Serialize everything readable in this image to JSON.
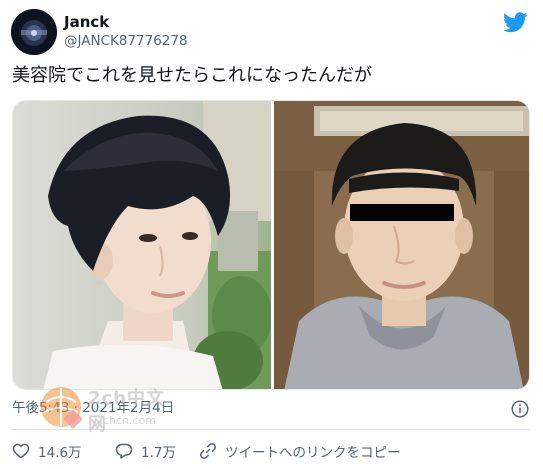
{
  "author": {
    "name": "Janck",
    "handle": "@JANCK87776278"
  },
  "tweet": {
    "text": "美容院でこれを見せたらこれになったんだが",
    "timestamp": "午後5:43 · 2021年2月4日"
  },
  "actions": {
    "like_count": "14.6万",
    "reply_count": "1.7万",
    "share_label": "ツイートへのリンクをコピー"
  },
  "watermark": {
    "text": "2ch中文网",
    "url": "2chcn.com"
  },
  "colors": {
    "twitter_blue": "#1d9bf0",
    "secondary_text": "#536471",
    "divider": "#e1e8ed"
  },
  "icons": {
    "brand": "twitter-bird-icon",
    "info": "info-icon",
    "like": "heart-icon",
    "reply": "speech-bubble-icon",
    "share": "link-icon"
  }
}
